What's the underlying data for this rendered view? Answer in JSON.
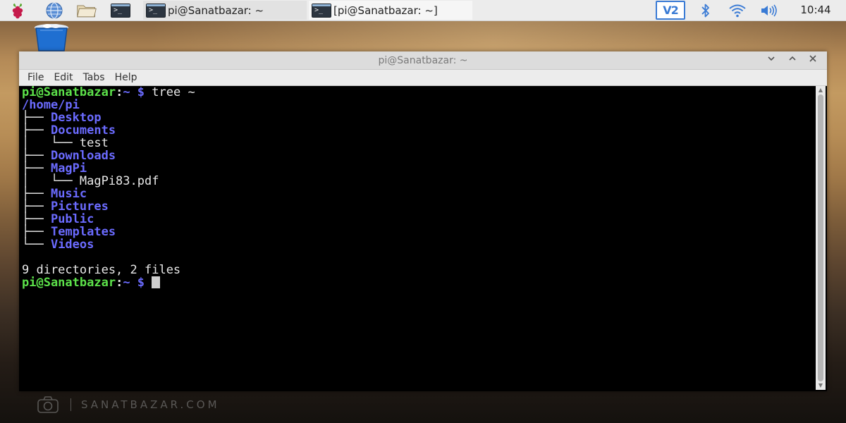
{
  "taskbar": {
    "icons": [
      "raspberry-menu-icon",
      "web-browser-icon",
      "file-manager-icon",
      "terminal-launcher-icon"
    ],
    "tasks": [
      {
        "label": "pi@Sanatbazar: ~",
        "state": "inactive"
      },
      {
        "label": "[pi@Sanatbazar: ~]",
        "state": "active"
      }
    ],
    "terminal_glyph": ">_",
    "tray": {
      "vnc_label": "V2",
      "icons": [
        "bluetooth-icon",
        "wifi-icon",
        "volume-icon"
      ]
    },
    "clock": "10:44"
  },
  "desktop": {
    "icons": [
      "trash-icon"
    ],
    "watermark": "SANATBAZAR.COM"
  },
  "terminal": {
    "title": "pi@Sanatbazar: ~",
    "window_controls": [
      "minimize",
      "maximize",
      "close"
    ],
    "menu": [
      "File",
      "Edit",
      "Tabs",
      "Help"
    ],
    "lines": [
      [
        {
          "t": "pi@Sanatbazar",
          "c": "green"
        },
        {
          "t": ":",
          "c": "white-b"
        },
        {
          "t": "~ $",
          "c": "blue"
        },
        {
          "t": " tree ~",
          "c": "white"
        }
      ],
      [
        {
          "t": "/home/pi",
          "c": "blue"
        }
      ],
      [
        {
          "t": "├── ",
          "c": "white"
        },
        {
          "t": "Desktop",
          "c": "blue"
        }
      ],
      [
        {
          "t": "├── ",
          "c": "white"
        },
        {
          "t": "Documents",
          "c": "blue"
        }
      ],
      [
        {
          "t": "│   └── test",
          "c": "white"
        }
      ],
      [
        {
          "t": "├── ",
          "c": "white"
        },
        {
          "t": "Downloads",
          "c": "blue"
        }
      ],
      [
        {
          "t": "├── ",
          "c": "white"
        },
        {
          "t": "MagPi",
          "c": "blue"
        }
      ],
      [
        {
          "t": "│   └── MagPi83.pdf",
          "c": "white"
        }
      ],
      [
        {
          "t": "├── ",
          "c": "white"
        },
        {
          "t": "Music",
          "c": "blue"
        }
      ],
      [
        {
          "t": "├── ",
          "c": "white"
        },
        {
          "t": "Pictures",
          "c": "blue"
        }
      ],
      [
        {
          "t": "├── ",
          "c": "white"
        },
        {
          "t": "Public",
          "c": "blue"
        }
      ],
      [
        {
          "t": "├── ",
          "c": "white"
        },
        {
          "t": "Templates",
          "c": "blue"
        }
      ],
      [
        {
          "t": "└── ",
          "c": "white"
        },
        {
          "t": "Videos",
          "c": "blue"
        }
      ],
      [],
      [
        {
          "t": "9 directories, 2 files",
          "c": "white"
        }
      ],
      [
        {
          "t": "pi@Sanatbazar",
          "c": "green"
        },
        {
          "t": ":",
          "c": "white-b"
        },
        {
          "t": "~ $",
          "c": "blue"
        },
        {
          "t": " ",
          "c": "white"
        },
        {
          "cursor": true
        }
      ]
    ]
  },
  "colors": {
    "prompt_user": "#5ce14a",
    "directory": "#6b6bff",
    "text": "#e8e8e8",
    "terminal_bg": "#000000",
    "vnc_accent": "#3a7bd5"
  }
}
